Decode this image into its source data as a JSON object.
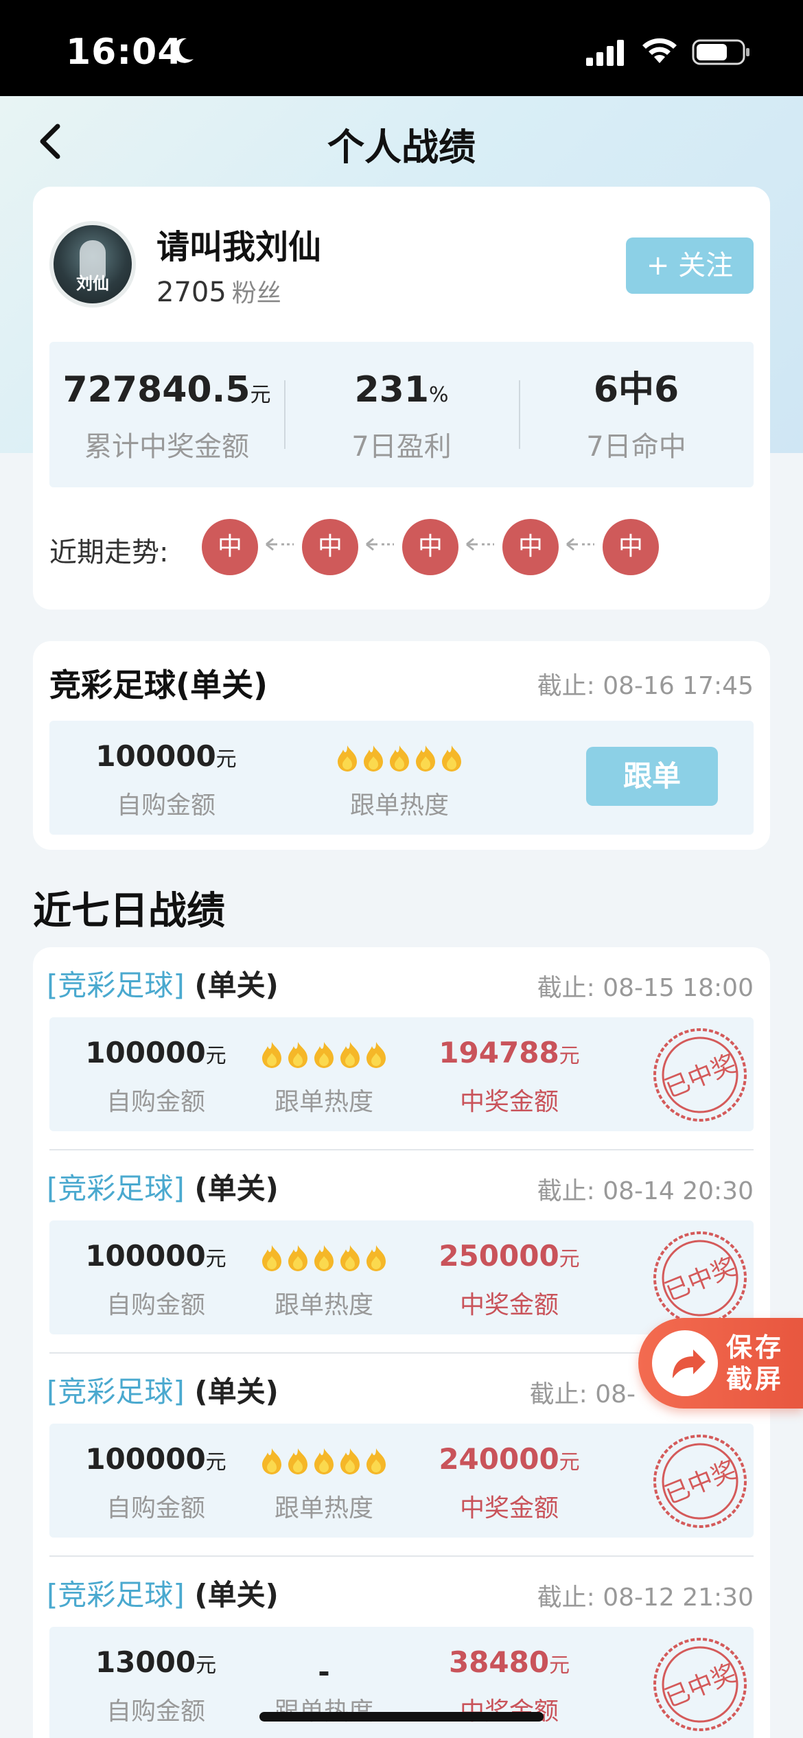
{
  "status": {
    "time": "16:04"
  },
  "header": {
    "title": "个人战绩"
  },
  "profile": {
    "avatar_text": "刘仙",
    "name": "请叫我刘仙",
    "fans_count": "2705",
    "fans_label": "粉丝",
    "follow_label": "+ 关注"
  },
  "stats": [
    {
      "value": "727840.5",
      "unit": "元",
      "label": "累计中奖金额"
    },
    {
      "value": "231",
      "unit": "%",
      "label": "7日盈利"
    },
    {
      "value": "6中6",
      "unit": "",
      "label": "7日命中"
    }
  ],
  "trend": {
    "label": "近期走势:",
    "items": [
      "中",
      "中",
      "中",
      "中",
      "中"
    ]
  },
  "current_pick": {
    "title": "竞彩足球(单关)",
    "deadline": "截止: 08-16 17:45",
    "amount": "100000",
    "unit": "元",
    "amount_label": "自购金额",
    "heat_label": "跟单热度",
    "heat_level": 5,
    "button": "跟单"
  },
  "section_title": "近七日战绩",
  "records": [
    {
      "tag": "竞彩足球",
      "type": "(单关)",
      "deadline": "截止: 08-15 18:00",
      "amount": "100000",
      "unit": "元",
      "amount_label": "自购金额",
      "heat": "",
      "heat_level": 5,
      "heat_label": "跟单热度",
      "prize": "194788",
      "prize_unit": "元",
      "prize_label": "中奖金额",
      "stamp": "已中奖"
    },
    {
      "tag": "竞彩足球",
      "type": "(单关)",
      "deadline": "截止: 08-14 20:30",
      "amount": "100000",
      "unit": "元",
      "amount_label": "自购金额",
      "heat": "",
      "heat_level": 5,
      "heat_label": "跟单热度",
      "prize": "250000",
      "prize_unit": "元",
      "prize_label": "中奖金额",
      "stamp": "已中奖"
    },
    {
      "tag": "竞彩足球",
      "type": "(单关)",
      "deadline": "截止: 08-",
      "amount": "100000",
      "unit": "元",
      "amount_label": "自购金额",
      "heat": "",
      "heat_level": 5,
      "heat_label": "跟单热度",
      "prize": "240000",
      "prize_unit": "元",
      "prize_label": "中奖金额",
      "stamp": "已中奖"
    },
    {
      "tag": "竞彩足球",
      "type": "(单关)",
      "deadline": "截止: 08-12 21:30",
      "amount": "13000",
      "unit": "元",
      "amount_label": "自购金额",
      "heat": "-",
      "heat_level": 0,
      "heat_label": "跟单热度",
      "prize": "38480",
      "prize_unit": "元",
      "prize_label": "中奖金额",
      "stamp": "已中奖"
    }
  ],
  "save_button": {
    "line1": "保存",
    "line2": "截屏"
  },
  "colors": {
    "accent": "#8cd0e6",
    "win_red": "#c9535a",
    "tag_blue": "#4aa9cf",
    "trend_red": "#cf5a5a"
  }
}
